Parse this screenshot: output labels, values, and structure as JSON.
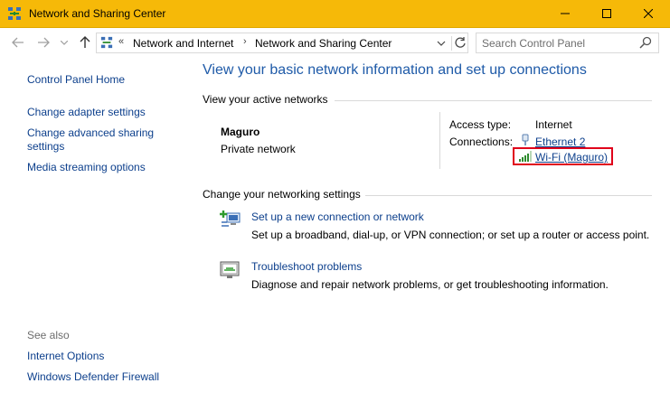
{
  "window": {
    "title": "Network and Sharing Center"
  },
  "address_bar": {
    "overflow": "«",
    "crumbs": [
      "Network and Internet",
      "Network and Sharing Center"
    ],
    "separator": "›"
  },
  "search": {
    "placeholder": "Search Control Panel"
  },
  "sidebar": {
    "home": "Control Panel Home",
    "items": [
      "Change adapter settings",
      "Change advanced sharing settings",
      "Media streaming options"
    ],
    "see_also_label": "See also",
    "see_also": [
      "Internet Options",
      "Windows Defender Firewall"
    ]
  },
  "main": {
    "heading": "View your basic network information and set up connections",
    "active_networks_heading": "View your active networks",
    "network": {
      "name": "Maguro",
      "category": "Private network",
      "access_type_label": "Access type:",
      "access_type_value": "Internet",
      "connections_label": "Connections:",
      "connections": [
        "Ethernet 2",
        "Wi-Fi (Maguro)"
      ]
    },
    "change_settings_heading": "Change your networking settings",
    "tasks": [
      {
        "title": "Set up a new connection or network",
        "description": "Set up a broadband, dial-up, or VPN connection; or set up a router or access point."
      },
      {
        "title": "Troubleshoot problems",
        "description": "Diagnose and repair network problems, or get troubleshooting information."
      }
    ]
  },
  "colors": {
    "titlebar": "#f6b908",
    "link": "#0c3f8c",
    "heading": "#1e5aa8",
    "highlight": "#e0001b"
  }
}
